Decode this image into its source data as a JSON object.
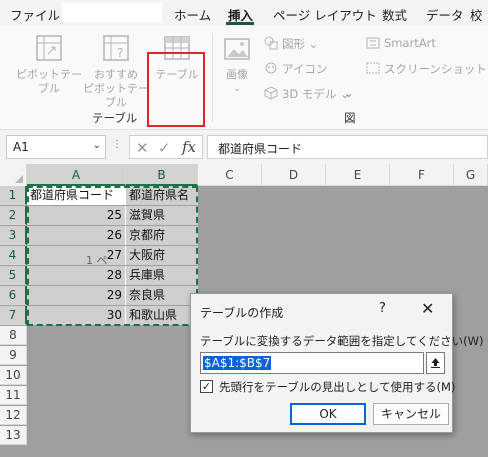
{
  "menu": {
    "file": "ファイル",
    "home": "ホーム",
    "insert": "挿入",
    "page_layout": "ページ レイアウト",
    "formulas": "数式",
    "data": "データ",
    "review": "校"
  },
  "ribbon": {
    "pivot_table": [
      "ピボットテー",
      "ブル"
    ],
    "recommended_pivot": [
      "おすすめ",
      "ピボットテーブル"
    ],
    "table": "テーブル",
    "images": "画像",
    "shapes": "図形",
    "icons": "アイコン",
    "models_3d": "3D モデル",
    "smartart": "SmartArt",
    "screenshot": "スクリーンショット",
    "group_tables": "テーブル",
    "group_illustrations": "図",
    "highlight_color": "#e0262b"
  },
  "formula_bar": {
    "name_box": "A1",
    "fx": "fx",
    "content": "都道府県コード"
  },
  "grid": {
    "columns": [
      "A",
      "B",
      "C",
      "D",
      "E",
      "F",
      "G"
    ],
    "rows": [
      "1",
      "2",
      "3",
      "4",
      "5",
      "6",
      "7",
      "8",
      "9",
      "10",
      "11",
      "12",
      "13"
    ],
    "headers": [
      "都道府県コード",
      "都道府県名"
    ],
    "data": [
      {
        "code": "25",
        "name": "滋賀県"
      },
      {
        "code": "26",
        "name": "京都府"
      },
      {
        "code": "27",
        "name": "大阪府"
      },
      {
        "code": "28",
        "name": "兵庫県"
      },
      {
        "code": "29",
        "name": "奈良県"
      },
      {
        "code": "30",
        "name": "和歌山県"
      }
    ],
    "cursor_ghost": "1 ペ",
    "selection_color": "#1e7145"
  },
  "dialog": {
    "title": "テーブルの作成",
    "help": "?",
    "close": "✕",
    "prompt": "テーブルに変換するデータ範囲を指定してください(W)",
    "range": "$A$1:$B$7",
    "checkbox_label": "先頭行をテーブルの見出しとして使用する(M)",
    "checkbox_checked": true,
    "ok": "OK",
    "cancel": "キャンセル",
    "accent": "#0a64d8"
  }
}
